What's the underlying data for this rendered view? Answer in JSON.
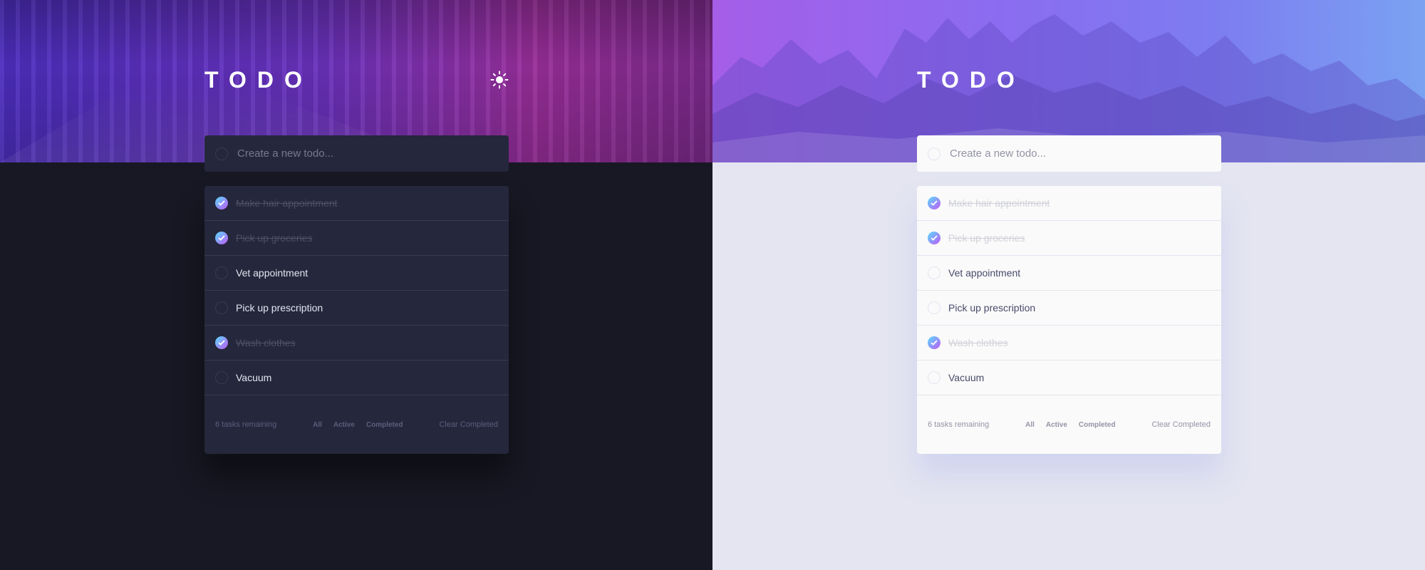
{
  "themes": [
    {
      "mode": "dark",
      "title": "TODO",
      "toggle_icon": "sun-icon",
      "input": {
        "placeholder": "Create a new todo..."
      },
      "todos": [
        {
          "text": "Make hair appointment",
          "completed": true
        },
        {
          "text": "Pick up groceries",
          "completed": true
        },
        {
          "text": "Vet appointment",
          "completed": false
        },
        {
          "text": "Pick up prescription",
          "completed": false
        },
        {
          "text": "Wash clothes",
          "completed": true
        },
        {
          "text": "Vacuum",
          "completed": false
        }
      ],
      "footer": {
        "remaining": "6 tasks remaining",
        "filters": [
          "All",
          "Active",
          "Completed"
        ],
        "clear": "Clear Completed"
      }
    },
    {
      "mode": "light",
      "title": "TODO",
      "toggle_icon": "moon-icon",
      "input": {
        "placeholder": "Create a new todo..."
      },
      "todos": [
        {
          "text": "Make hair appointment",
          "completed": true
        },
        {
          "text": "Pick up groceries",
          "completed": true
        },
        {
          "text": "Vet appointment",
          "completed": false
        },
        {
          "text": "Pick up prescription",
          "completed": false
        },
        {
          "text": "Wash clothes",
          "completed": true
        },
        {
          "text": "Vacuum",
          "completed": false
        }
      ],
      "footer": {
        "remaining": "6 tasks remaining",
        "filters": [
          "All",
          "Active",
          "Completed"
        ],
        "clear": "Clear Completed"
      }
    }
  ],
  "colors": {
    "dark_bg": "#181824",
    "dark_card": "#25273c",
    "light_bg": "#e4e5f1",
    "light_card": "#fafafa",
    "check_gradient_start": "#57ddff",
    "check_gradient_end": "#c058f3"
  }
}
